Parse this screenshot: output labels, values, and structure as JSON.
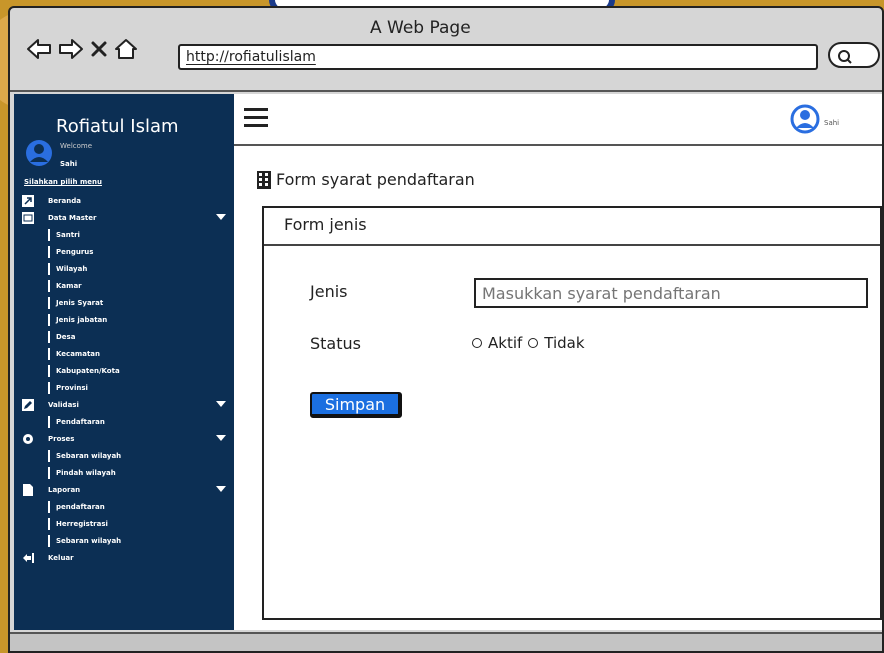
{
  "window": {
    "title": "A Web Page"
  },
  "browser": {
    "url": "http://rofiatulislam"
  },
  "sidebar": {
    "brand": "Rofiatul Islam",
    "welcome": "Welcome",
    "username": "Sahi",
    "hint": "Silahkan pilih menu",
    "items": [
      {
        "label": "Beranda",
        "type": "top",
        "icon": "external-link-icon"
      },
      {
        "label": "Data Master",
        "type": "group",
        "icon": "folder-icon",
        "caret": true
      },
      {
        "label": "Santri",
        "type": "sub"
      },
      {
        "label": "Pengurus",
        "type": "sub"
      },
      {
        "label": "Wilayah",
        "type": "sub"
      },
      {
        "label": "Kamar",
        "type": "sub"
      },
      {
        "label": "Jenis Syarat",
        "type": "sub"
      },
      {
        "label": "Jenis jabatan",
        "type": "sub"
      },
      {
        "label": "Desa",
        "type": "sub"
      },
      {
        "label": "Kecamatan",
        "type": "sub"
      },
      {
        "label": "Kabupaten/Kota",
        "type": "sub"
      },
      {
        "label": "Provinsi",
        "type": "sub"
      },
      {
        "label": "Validasi",
        "type": "group",
        "icon": "edit-icon",
        "caret": true
      },
      {
        "label": "Pendaftaran",
        "type": "sub"
      },
      {
        "label": "Proses",
        "type": "group",
        "icon": "gear-icon",
        "caret": true
      },
      {
        "label": "Sebaran wilayah",
        "type": "sub"
      },
      {
        "label": "Pindah wilayah",
        "type": "sub"
      },
      {
        "label": "Laporan",
        "type": "group",
        "icon": "document-icon",
        "caret": true
      },
      {
        "label": "pendaftaran",
        "type": "sub"
      },
      {
        "label": "Herregistrasi",
        "type": "sub"
      },
      {
        "label": "Sebaran wilayah",
        "type": "sub"
      },
      {
        "label": "Keluar",
        "type": "top",
        "icon": "logout-icon"
      }
    ]
  },
  "header": {
    "username": "Sahi"
  },
  "page": {
    "title": "Form syarat pendaftaran"
  },
  "form": {
    "panel_title": "Form jenis",
    "jenis_label": "Jenis",
    "jenis_placeholder": "Masukkan syarat pendaftaran",
    "status_label": "Status",
    "status_options": [
      "Aktif",
      "Tidak"
    ],
    "submit_label": "Simpan"
  },
  "colors": {
    "sidebar": "#0c2f54",
    "accent": "#1b6fe0",
    "avatar": "#2a6ee0"
  }
}
